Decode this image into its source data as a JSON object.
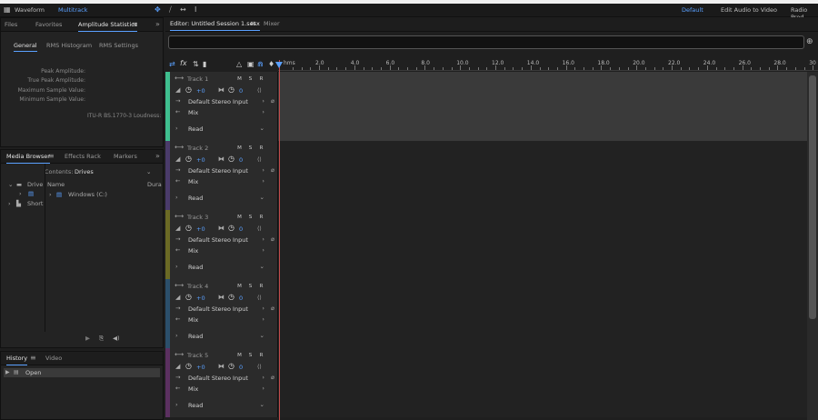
{
  "toolbar": {
    "waveform": "Waveform",
    "multitrack": "Multitrack",
    "workspace": "Default",
    "edit_audio_video": "Edit Audio to Video",
    "radio": "Radio Prod"
  },
  "left_top_panel": {
    "tabs": [
      "Files",
      "Favorites",
      "Amplitude Statistics"
    ],
    "subtabs": [
      "General",
      "RMS Histogram",
      "RMS Settings"
    ],
    "stats": [
      "Peak Amplitude:",
      "True Peak Amplitude:",
      "Maximum Sample Value:",
      "Minimum Sample Value:"
    ],
    "loudness": "ITU-R BS.1770-3 Loudness:"
  },
  "media_browser": {
    "tabs": [
      "Media Browser",
      "Effects Rack",
      "Markers"
    ],
    "contents_label": "Contents:",
    "contents_value": "Drives",
    "tree": [
      "Drive",
      "Short"
    ],
    "col_name": "Name",
    "col_dur": "Dura",
    "items": [
      "Windows (C:)"
    ]
  },
  "history": {
    "tabs": [
      "History",
      "Video"
    ],
    "items": [
      "Open"
    ]
  },
  "editor": {
    "tabs": [
      "Editor: Untitled Session 1.sesx",
      "Mixer"
    ],
    "ruler_start": "hms",
    "ruler_labels": [
      "2.0",
      "4.0",
      "6.0",
      "8.0",
      "10.0",
      "12.0",
      "14.0",
      "16.0",
      "18.0",
      "20.0",
      "22.0",
      "24.0",
      "26.0",
      "28.0",
      "30"
    ],
    "tracks": [
      {
        "name": "Track 1",
        "color": "#3fbf8f"
      },
      {
        "name": "Track 2",
        "color": "#4a3b6a"
      },
      {
        "name": "Track 3",
        "color": "#6b6a25"
      },
      {
        "name": "Track 4",
        "color": "#2b4f6b"
      },
      {
        "name": "Track 5",
        "color": "#5b3060"
      }
    ],
    "track_controls": {
      "m": "M",
      "s": "S",
      "r": "R",
      "volume": "+0",
      "pan": "0",
      "input": "Default Stereo Input",
      "output": "Mix",
      "automation": "Read"
    }
  }
}
